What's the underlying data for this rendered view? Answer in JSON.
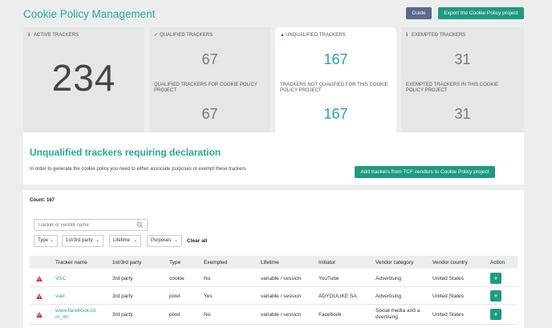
{
  "header": {
    "title": "Cookie Policy Management",
    "guide_label": "Guide",
    "export_label": "Export the Cookie Policy project"
  },
  "stats": {
    "active": {
      "label": "ACTIVE TRACKERS",
      "value": "234",
      "icon": "info-icon"
    },
    "qualified": {
      "label": "QUALIFIED TRACKERS",
      "value": "67",
      "sub_label": "QUALIFIED TRACKERS FOR COOKIE POLICY PROJECT",
      "sub_value": "67",
      "icon": "check-icon",
      "icon_color": "#4caf50"
    },
    "unqualified": {
      "label": "UNQUALIFIED TRACKERS",
      "value": "167",
      "sub_label": "TRACKERS NOT QUALIFIED FOR THIS COOKIE POLICY PROJECT",
      "sub_value": "167",
      "icon": "warning-icon",
      "icon_color": "#d32f2f"
    },
    "exempted": {
      "label": "EXEMPTED TRACKERS",
      "value": "31",
      "sub_label": "EXEMPTED TRACKERS IN THIS COOKIE POLICY PROJECT",
      "sub_value": "31",
      "icon": "info-icon"
    }
  },
  "declare": {
    "title": "Unqualified trackers requiring declaration",
    "text": "In order to generate the cookie policy you need to either associate purposes or exempt these trackers",
    "add_button": "Add trackers from TCF vendors to Cookie Policy project"
  },
  "list": {
    "count_label": "Count: 167",
    "search_placeholder": "Tracker or vendor name",
    "filters": [
      "Type",
      "1st/3rd party",
      "Lifetime",
      "Purposes"
    ],
    "clear_all": "Clear all",
    "columns": [
      "Tracker name",
      "1st/3rd party",
      "Type",
      "Exempted",
      "Lifetime",
      "Initiator",
      "Vendor category",
      "Vendor country",
      "Action"
    ],
    "rows": [
      {
        "name": "VSC",
        "party": "3rd party",
        "type": "cookie",
        "exempted": "No",
        "lifetime": "variable / session",
        "initiator": "YouTube",
        "category": "Advertising",
        "country": "United States",
        "action": "+"
      },
      {
        "name": "via#",
        "party": "3rd party",
        "type": "pixel",
        "exempted": "Yes",
        "lifetime": "variable / session",
        "initiator": "ADYOULIKE SA",
        "category": "Advertising",
        "country": "United States",
        "action": "+"
      },
      {
        "name": "www.facebook.com_/tr/",
        "name_line1": "www.facebook.co",
        "name_line2": "m_/tr/",
        "party": "3rd party",
        "type": "pixel",
        "exempted": "No",
        "lifetime": "variable / session",
        "initiator": "Facebook",
        "category": "Social media and a dvertising",
        "category_line1": "Social media and a",
        "category_line2": "dvertising",
        "country": "United States",
        "action": "+"
      }
    ]
  },
  "colors": {
    "accent": "#26a69a",
    "button": "#1f9a7f",
    "guide": "#5a6a8e",
    "warning": "#d32f2f"
  }
}
